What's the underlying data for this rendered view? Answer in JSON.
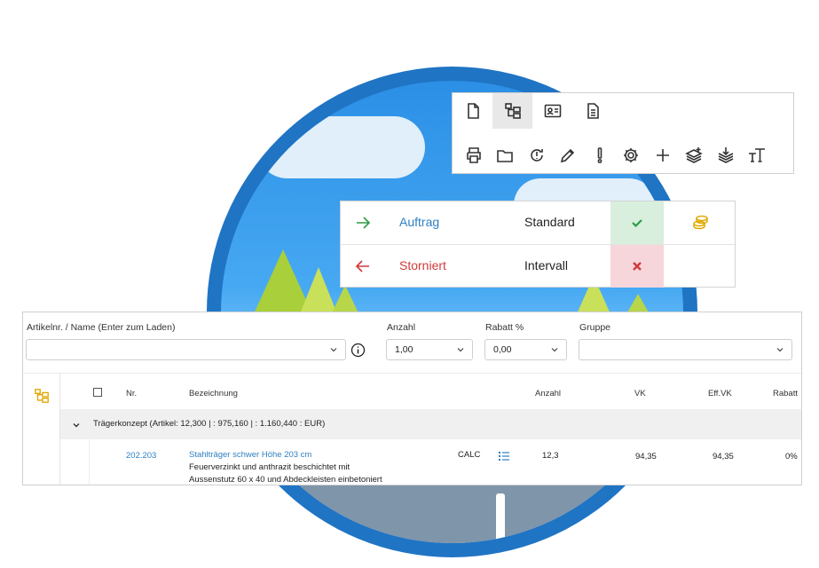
{
  "colors": {
    "accent_blue": "#2f7fc1",
    "green": "#2e9b46",
    "red": "#d23a3a",
    "gold": "#e0a800"
  },
  "toolbar": {
    "row1": [
      {
        "icon": "document-icon"
      },
      {
        "icon": "tree-structure-icon",
        "active": true
      },
      {
        "icon": "contact-card-icon"
      },
      {
        "icon": "text-document-icon"
      }
    ],
    "row2": [
      {
        "icon": "printer-icon"
      },
      {
        "icon": "folder-icon"
      },
      {
        "icon": "refresh-alert-icon"
      },
      {
        "icon": "pencil-icon"
      },
      {
        "icon": "exclamation-icon"
      },
      {
        "icon": "gear-icon"
      },
      {
        "icon": "plus-icon"
      },
      {
        "icon": "layers-add-icon"
      },
      {
        "icon": "layers-download-icon"
      },
      {
        "icon": "text-size-icon"
      }
    ]
  },
  "status": {
    "rows": [
      {
        "label": "Auftrag",
        "type": "Standard",
        "arrow": "arrow-right-icon",
        "mark": "checkmark-icon"
      },
      {
        "label": "Storniert",
        "type": "Intervall",
        "arrow": "arrow-left-icon",
        "mark": "cross-icon"
      }
    ]
  },
  "order": {
    "article_label": "Artikelnr. / Name (Enter zum Laden)",
    "article_value": "",
    "quantity_label": "Anzahl",
    "quantity_value": "1,00",
    "discount_label": "Rabatt %",
    "discount_value": "0,00",
    "group_label": "Gruppe",
    "group_value": "",
    "columns": {
      "nr": "Nr.",
      "description": "Bezeichnung",
      "quantity": "Anzahl",
      "vk": "VK",
      "eff_vk": "Eff.VK",
      "discount": "Rabatt"
    },
    "group_row": "Trägerkonzept (Artikel: 12,300 | : 975,160 | : 1.160,440 :  EUR)",
    "item": {
      "nr": "202.203",
      "title": "Stahlträger schwer Höhe 203 cm",
      "desc_line1": "Feuerverzinkt und anthrazit beschichtet mit",
      "desc_line2": "Aussenstutz 60 x 40 und Abdeckleisten einbetoniert",
      "calc": "CALC",
      "quantity": "12,3",
      "vk": "94,35",
      "eff_vk": "94,35",
      "discount": "0%"
    }
  }
}
